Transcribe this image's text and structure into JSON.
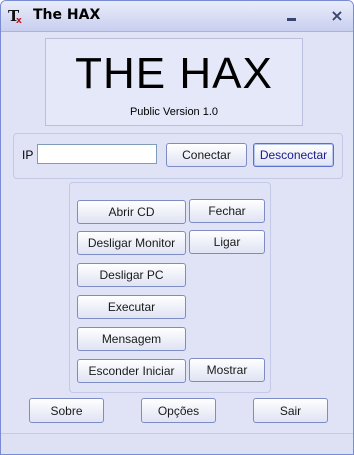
{
  "window": {
    "title": "The HAX"
  },
  "titlebar": {
    "minimize_icon": "minimize-icon",
    "close_symbol": "×"
  },
  "logo": {
    "title": "THE HAX",
    "subtitle": "Public Version 1.0"
  },
  "connection": {
    "ip_label": "IP",
    "ip_value": "",
    "connect_label": "Conectar",
    "disconnect_label": "Desconectar"
  },
  "commands": {
    "open_cd": "Abrir CD",
    "close_cd": "Fechar",
    "monitor_off": "Desligar Monitor",
    "monitor_on": "Ligar",
    "shutdown_pc": "Desligar PC",
    "execute": "Executar",
    "message": "Mensagem",
    "hide_start": "Esconder Iniciar",
    "show_start": "Mostrar"
  },
  "footer": {
    "about": "Sobre",
    "options": "Opções",
    "exit": "Sair"
  }
}
